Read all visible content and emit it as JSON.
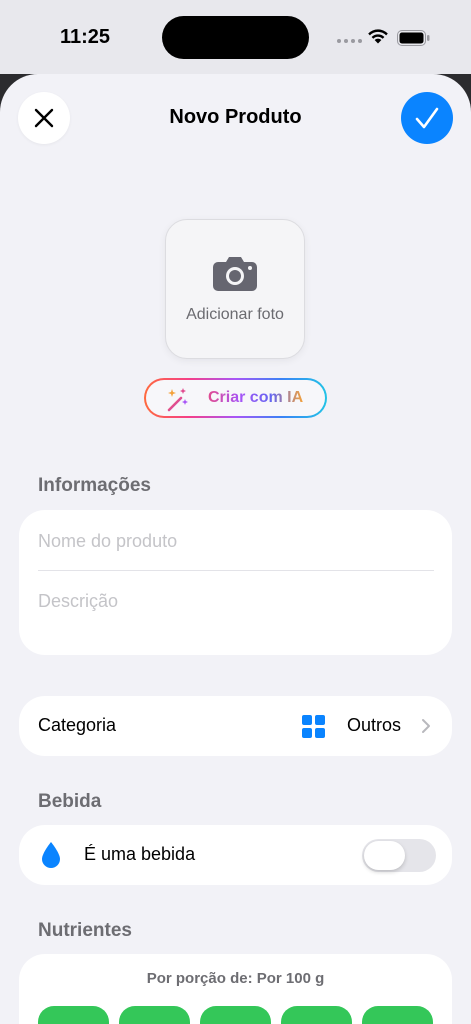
{
  "status_bar": {
    "time": "11:25"
  },
  "nav": {
    "title": "Novo Produto",
    "close_icon": "xmark",
    "confirm_icon": "checkmark",
    "accent": "#0a84ff"
  },
  "photo": {
    "label": "Adicionar foto",
    "icon": "camera-fill"
  },
  "ai_button": {
    "label": "Criar com IA",
    "icon": "wand-and-sparkles"
  },
  "info_section": {
    "header": "Informações",
    "name_placeholder": "Nome do produto",
    "description_placeholder": "Descrição"
  },
  "category": {
    "label": "Categoria",
    "value": "Outros",
    "icon": "square-grid-2x2-fill"
  },
  "beverage_section": {
    "header": "Bebida",
    "label": "É uma bebida",
    "icon": "drop-fill",
    "toggle_on": false
  },
  "nutrients_section": {
    "header": "Nutrientes",
    "portion_label": "Por porção de: Por 100 g",
    "pill_color": "#34c759"
  }
}
